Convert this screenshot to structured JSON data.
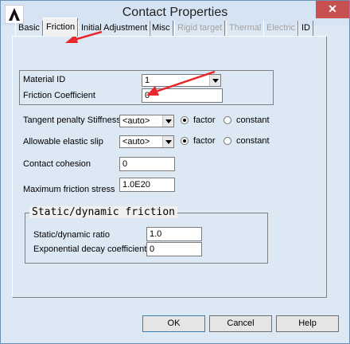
{
  "window": {
    "title": "Contact Properties",
    "close_glyph": "✕",
    "icon": "ansys-logo-icon"
  },
  "tabs": [
    {
      "label": "Basic",
      "state": "normal"
    },
    {
      "label": "Friction",
      "state": "active"
    },
    {
      "label": "Initial Adjustment",
      "state": "normal"
    },
    {
      "label": "Misc",
      "state": "normal"
    },
    {
      "label": "Rigid target",
      "state": "disabled"
    },
    {
      "label": "Thermal",
      "state": "disabled"
    },
    {
      "label": "Electric",
      "state": "disabled"
    },
    {
      "label": "ID",
      "state": "normal"
    }
  ],
  "material": {
    "label": "Material ID",
    "value": "1"
  },
  "friction_coefficient": {
    "label": "Friction Coefficient",
    "value": "0"
  },
  "tangent_stiffness": {
    "label": "Tangent penalty Stiffness",
    "value": "<auto>",
    "radio_factor": "factor",
    "radio_constant": "constant",
    "selected": "factor"
  },
  "elastic_slip": {
    "label": "Allowable elastic slip",
    "value": "<auto>",
    "radio_factor": "factor",
    "radio_constant": "constant",
    "selected": "factor"
  },
  "cohesion": {
    "label": "Contact cohesion",
    "value": "0"
  },
  "max_friction_stress": {
    "label": "Maximum friction stress",
    "value": "1.0E20"
  },
  "static_dynamic": {
    "title": "Static/dynamic friction",
    "ratio_label": "Static/dynamic ratio",
    "ratio_value": "1.0",
    "decay_label": "Exponential decay coefficient",
    "decay_value": "0"
  },
  "buttons": {
    "ok": "OK",
    "cancel": "Cancel",
    "help": "Help"
  },
  "colors": {
    "annotation_arrow": "#e8262b",
    "close_button": "#c75050"
  }
}
